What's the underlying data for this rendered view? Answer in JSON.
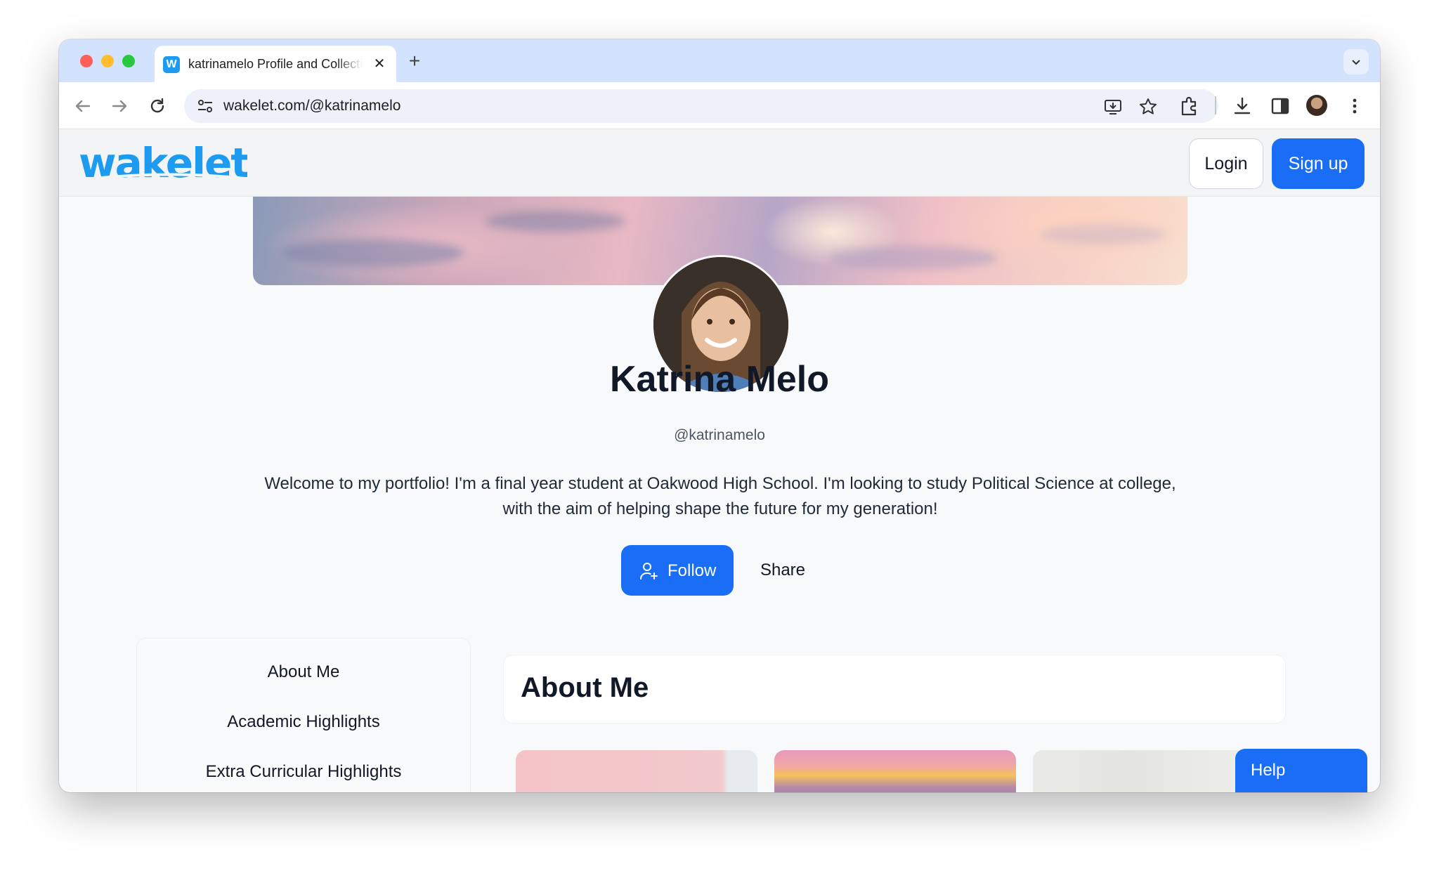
{
  "browser": {
    "tab_title": "katrinamelo Profile and Collections | Wakelet",
    "url": "wakelet.com/@katrinamelo",
    "favicon_letter": "W",
    "icons": [
      "back-arrow-icon",
      "forward-arrow-icon",
      "reload-icon",
      "site-settings-icon",
      "install-app-icon",
      "bookmark-star-icon",
      "extensions-icon",
      "download-icon",
      "side-panel-icon",
      "profile-avatar-icon",
      "more-menu-icon",
      "tab-close-icon",
      "new-tab-icon",
      "tab-list-chevron-icon"
    ]
  },
  "header": {
    "logo_text": "wakelet",
    "login_label": "Login",
    "signup_label": "Sign up",
    "brand_color": "#1d9bf0",
    "accent_color": "#1a6ef5"
  },
  "profile": {
    "name": "Katrina Melo",
    "handle": "@katrinamelo",
    "bio": "Welcome to my portfolio! I'm a final year student at Oakwood High School. I'm looking to study Political Science at college, with the aim of helping shape the future for my generation!",
    "follow_label": "Follow",
    "share_label": "Share"
  },
  "sidebar": {
    "items": [
      {
        "label": "About Me"
      },
      {
        "label": "Academic Highlights"
      },
      {
        "label": "Extra Curricular Highlights"
      }
    ]
  },
  "main": {
    "section_title": "About Me"
  },
  "help": {
    "label": "Help"
  }
}
